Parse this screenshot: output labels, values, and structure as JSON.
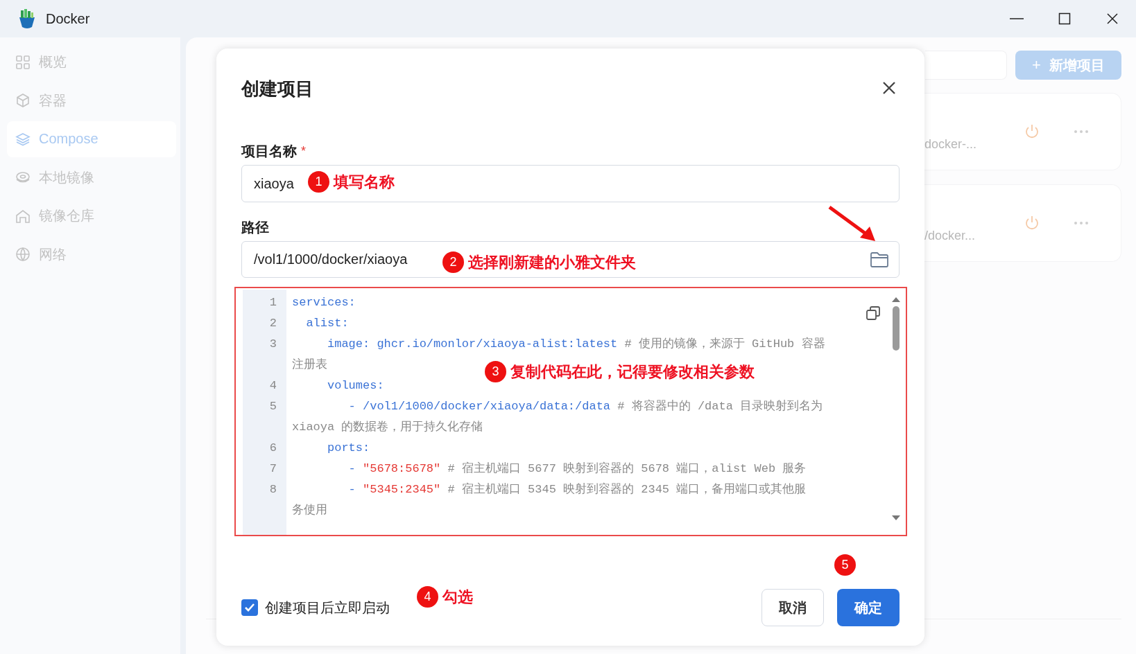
{
  "window": {
    "title": "Docker"
  },
  "sidebar": {
    "items": [
      {
        "label": "概览",
        "selected": false
      },
      {
        "label": "容器",
        "selected": false
      },
      {
        "label": "Compose",
        "selected": true
      },
      {
        "label": "本地镜像",
        "selected": false
      },
      {
        "label": "镜像仓库",
        "selected": false
      },
      {
        "label": "网络",
        "selected": false
      }
    ]
  },
  "main": {
    "add_button": {
      "icon": "+",
      "label": "新增项目"
    },
    "cards": [
      {
        "path": "docker-..."
      },
      {
        "path": "/docker..."
      }
    ]
  },
  "dialog": {
    "title": "创建项目",
    "fields": [
      {
        "label": "项目名称",
        "required_mark": "*",
        "value": "xiaoya",
        "kind": "text"
      },
      {
        "label": "路径",
        "value": "/vol1/1000/docker/xiaoya",
        "kind": "folder"
      }
    ],
    "editor": {
      "lines": [
        {
          "number": "1",
          "rows": [
            [
              {
                "kind": "code",
                "text": "services:"
              }
            ]
          ]
        },
        {
          "number": "2",
          "rows": [
            [
              {
                "kind": "code",
                "text": "  alist:"
              }
            ]
          ]
        },
        {
          "number": "3",
          "rows": [
            [
              {
                "kind": "code",
                "text": "     image: ghcr.io/monlor/xiaoya-alist:latest "
              },
              {
                "kind": "comment",
                "text": "# 使用的镜像，来源于 GitHub 容器"
              }
            ],
            [
              {
                "kind": "comment",
                "text": "注册表"
              }
            ]
          ]
        },
        {
          "number": "4",
          "rows": [
            [
              {
                "kind": "code",
                "text": "     volumes:"
              }
            ]
          ]
        },
        {
          "number": "5",
          "rows": [
            [
              {
                "kind": "code",
                "text": "        - /vol1/1000/docker/xiaoya/data:/data "
              },
              {
                "kind": "comment",
                "text": "# 将容器中的 /data 目录映射到名为"
              }
            ],
            [
              {
                "kind": "comment",
                "text": "xiaoya 的数据卷，用于持久化存储"
              }
            ]
          ]
        },
        {
          "number": "6",
          "rows": [
            [
              {
                "kind": "code",
                "text": "     ports:"
              }
            ]
          ]
        },
        {
          "number": "7",
          "rows": [
            [
              {
                "kind": "code",
                "text": "        - "
              },
              {
                "kind": "string",
                "text": "\"5678:5678\""
              },
              {
                "kind": "comment",
                "text": " # 宿主机端口 5677 映射到容器的 5678 端口，alist Web 服务"
              }
            ]
          ]
        },
        {
          "number": "8",
          "rows": [
            [
              {
                "kind": "code",
                "text": "        - "
              },
              {
                "kind": "string",
                "text": "\"5345:2345\""
              },
              {
                "kind": "comment",
                "text": " # 宿主机端口 5345 映射到容器的 2345 端口，备用端口或其他服"
              }
            ],
            [
              {
                "kind": "comment",
                "text": "务使用"
              }
            ]
          ]
        }
      ]
    },
    "autostart": {
      "label": "创建项目后立即启动",
      "checked": true
    },
    "buttons": [
      {
        "label": "取消",
        "kind": "secondary"
      },
      {
        "label": "确定",
        "kind": "primary"
      }
    ]
  },
  "annotations": [
    {
      "number": "1",
      "text": "填写名称"
    },
    {
      "number": "2",
      "text": "选择刚新建的小雅文件夹"
    },
    {
      "number": "3",
      "text": "复制代码在此，记得要修改相关参数"
    },
    {
      "number": "4",
      "text": "勾选"
    },
    {
      "number": "5"
    }
  ]
}
